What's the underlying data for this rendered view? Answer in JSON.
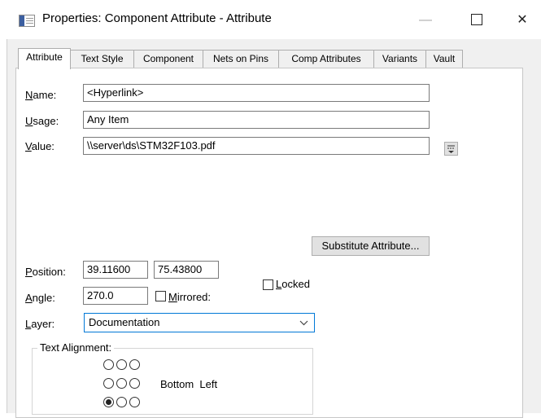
{
  "window": {
    "title": "Properties: Component Attribute - Attribute",
    "min_glyph": "—",
    "close_glyph": "✕"
  },
  "tabs": [
    {
      "label": "Attribute",
      "active": true
    },
    {
      "label": "Text Style",
      "active": false
    },
    {
      "label": "Component",
      "active": false
    },
    {
      "label": "Nets on Pins",
      "active": false
    },
    {
      "label": "Comp Attributes",
      "active": false
    },
    {
      "label": "Variants",
      "active": false
    },
    {
      "label": "Vault",
      "active": false
    }
  ],
  "form": {
    "name_label_u": "N",
    "name_label_rest": "ame:",
    "name_value": "<Hyperlink>",
    "usage_label_u": "U",
    "usage_label_rest": "sage:",
    "usage_value": "Any Item",
    "value_label_u": "V",
    "value_label_rest": "alue:",
    "value_value": "\\\\server\\ds\\STM32F103.pdf",
    "substitute_button": "Substitute Attribute...",
    "position_label_u": "P",
    "position_label_rest": "osition:",
    "position_x": "39.11600",
    "position_y": "75.43800",
    "locked_label_u": "L",
    "locked_label_rest": "ocked",
    "locked_checked": false,
    "angle_label_u": "A",
    "angle_label_rest": "ngle:",
    "angle_value": "270.0",
    "mirrored_label_u": "M",
    "mirrored_label_rest": "irrored:",
    "mirrored_checked": false,
    "layer_label_u": "L",
    "layer_label_rest": "ayer:",
    "layer_value": "Documentation"
  },
  "alignment": {
    "legend": "Text Alignment:",
    "selected_row": 3,
    "selected_col": 1,
    "description": "Bottom  Left"
  }
}
